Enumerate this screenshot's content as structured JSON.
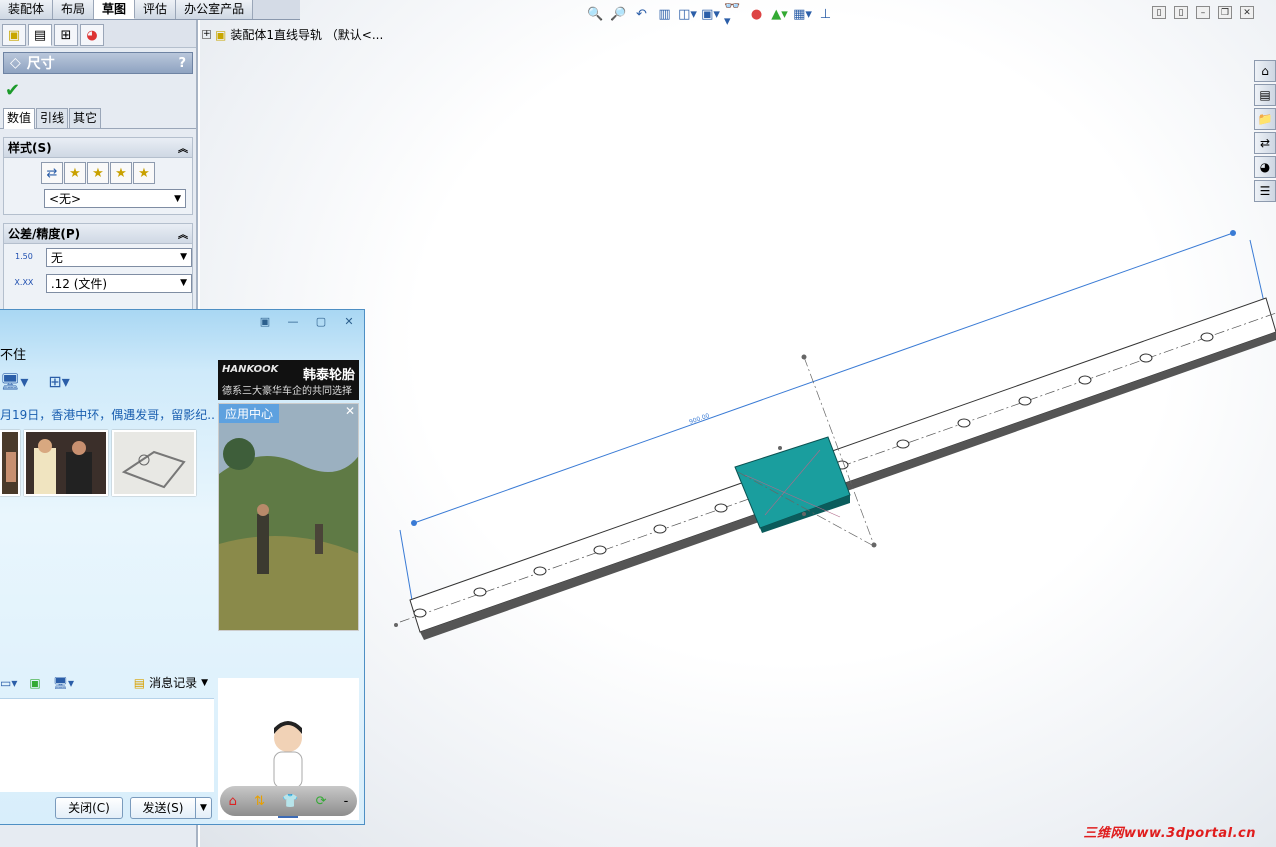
{
  "top_tabs": [
    "装配体",
    "布局",
    "草图",
    "评估",
    "办公室产品"
  ],
  "top_tab_active": 2,
  "property_manager": {
    "title": "尺寸",
    "help": "?",
    "ok": "✔",
    "tabs": [
      "数值",
      "引线",
      "其它"
    ],
    "style_group": {
      "title": "样式(S)",
      "combo": "<无>"
    },
    "tolerance_group": {
      "title": "公差/精度(P)",
      "tolerance_value": "无",
      "tolerance_icon": "1.50",
      "precision_value": ".12 (文件)",
      "precision_icon": "X.XX"
    }
  },
  "tree_root": "装配体1直线导轨 （默认<...",
  "viewport": {
    "dimension_text": "900.00",
    "body_color": "#1a9e9e",
    "accent": "#3a7bd5"
  },
  "chat": {
    "status": "不住",
    "news": "月19日，香港中环，偶遇发哥，留影纪...",
    "ad": {
      "brand": "HANKOOK",
      "cn": "韩泰轮胎",
      "slogan": "德系三大豪华车企的共同选择"
    },
    "app_center": "应用中心",
    "history": "消息记录",
    "close": "关闭(C)",
    "send": "发送(S)"
  },
  "watermark": "三维网www.3dportal.cn"
}
